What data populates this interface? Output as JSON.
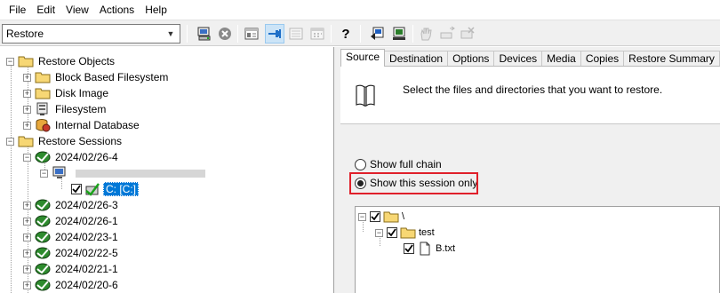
{
  "menu": [
    "File",
    "Edit",
    "View",
    "Actions",
    "Help"
  ],
  "toolbar": {
    "context_value": "Restore",
    "icons": [
      "restore-drive-icon",
      "stop-icon",
      "properties-icon",
      "pin-icon",
      "list-view-icon",
      "calendar-icon",
      "help-icon",
      "start-restore-icon",
      "preview-icon",
      "hand-icon",
      "eject-icon",
      "cancel-icon"
    ]
  },
  "tree": {
    "restore_objects": "Restore Objects",
    "block_based": "Block Based Filesystem",
    "disk_image": "Disk Image",
    "filesystem": "Filesystem",
    "internal_db": "Internal Database",
    "restore_sessions": "Restore Sessions",
    "session_open": "2024/02/26-4",
    "drive": "C: [C:]",
    "sessions": [
      "2024/02/26-3",
      "2024/02/26-1",
      "2024/02/23-1",
      "2024/02/22-5",
      "2024/02/21-1",
      "2024/02/20-6"
    ]
  },
  "tabs": [
    "Source",
    "Destination",
    "Options",
    "Devices",
    "Media",
    "Copies",
    "Restore Summary"
  ],
  "source": {
    "info": "Select the files and directories that you want to restore.",
    "radio_full": "Show full chain",
    "radio_session": "Show this session only",
    "files": {
      "root": "\\",
      "folder": "test",
      "file": "B.txt"
    }
  },
  "colors": {
    "selection": "#0078d7",
    "highlight": "#e0202a",
    "folder": "#f7d774"
  }
}
